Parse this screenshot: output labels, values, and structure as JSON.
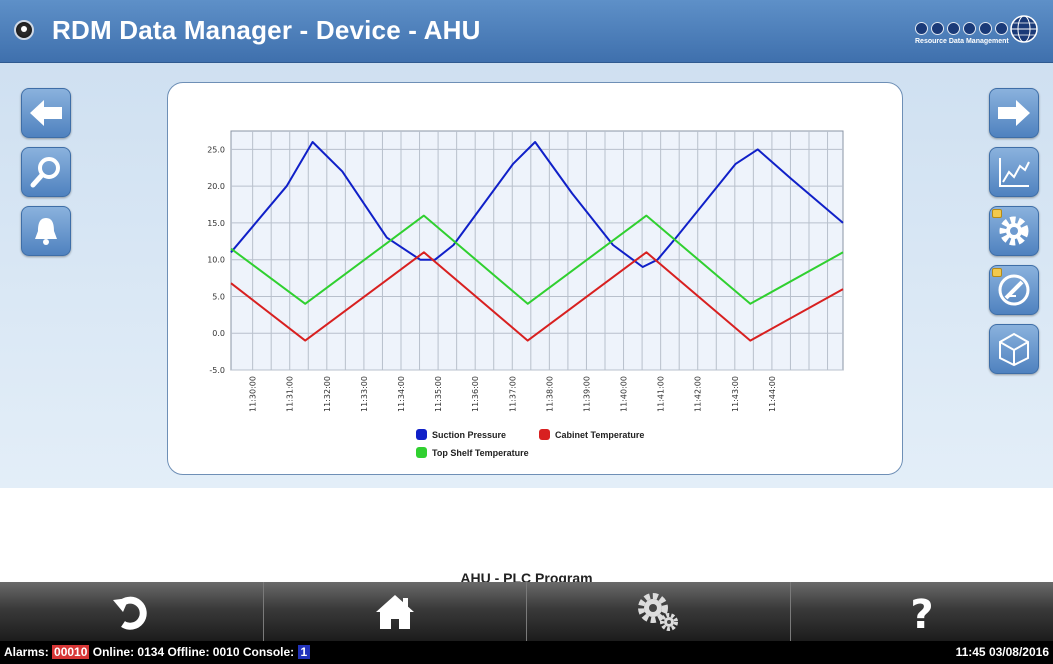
{
  "header": {
    "title": "RDM Data Manager - Device - AHU",
    "logo_text": "Resource Data Management"
  },
  "chart_data": {
    "type": "line",
    "ylim": [
      -5,
      27.5
    ],
    "yticks": [
      "25.0",
      "20.0",
      "15.0",
      "10.0",
      "5.0",
      "0.0",
      "-5.0"
    ],
    "ytick_values": [
      25,
      20,
      15,
      10,
      5,
      0,
      -5
    ],
    "xlim_minutes": [
      0,
      16.5
    ],
    "xticks": [
      "11:30:00",
      "11:31:00",
      "11:32:00",
      "11:33:00",
      "11:34:00",
      "11:35:00",
      "11:36:00",
      "11:37:00",
      "11:38:00",
      "11:39:00",
      "11:40:00",
      "11:41:00",
      "11:42:00",
      "11:43:00",
      "11:44:00"
    ],
    "x_start_time": "11:29:25",
    "series": [
      {
        "name": "Suction Pressure",
        "color": "#1020c8",
        "x": [
          0,
          1.5,
          2.2,
          3.0,
          4.2,
          5.1,
          5.5,
          6.0,
          7.6,
          8.2,
          9.2,
          10.3,
          11.1,
          11.5,
          12.0,
          13.6,
          14.2,
          15.1,
          16.5
        ],
        "values": [
          11,
          20,
          26,
          22,
          13,
          10,
          10,
          12,
          23,
          26,
          19,
          12,
          9,
          10,
          13,
          23,
          25,
          21,
          15
        ]
      },
      {
        "name": "Cabinet Temperature",
        "color": "#d82020",
        "x": [
          0,
          2.0,
          5.2,
          8.0,
          11.2,
          14.0,
          16.5
        ],
        "values": [
          6.8,
          -1,
          11,
          -1,
          11,
          -1,
          6
        ]
      },
      {
        "name": "Top Shelf Temperature",
        "color": "#30d030",
        "x": [
          0,
          2.0,
          5.2,
          8.0,
          11.2,
          14.0,
          16.5
        ],
        "values": [
          11.5,
          4,
          16,
          4,
          16,
          4,
          11
        ]
      }
    ]
  },
  "legend": {
    "suction": "Suction Pressure",
    "cabinet": "Cabinet Temperature",
    "topshelf": "Top Shelf Temperature"
  },
  "program_label": "AHU - PLC Program",
  "status": {
    "alarms_label": "Alarms:",
    "alarms_value": "00010",
    "online": "Online: 0134",
    "offline": "Offline: 0010",
    "console_label": "Console:",
    "console_value": "1",
    "datetime": "11:45 03/08/2016"
  }
}
